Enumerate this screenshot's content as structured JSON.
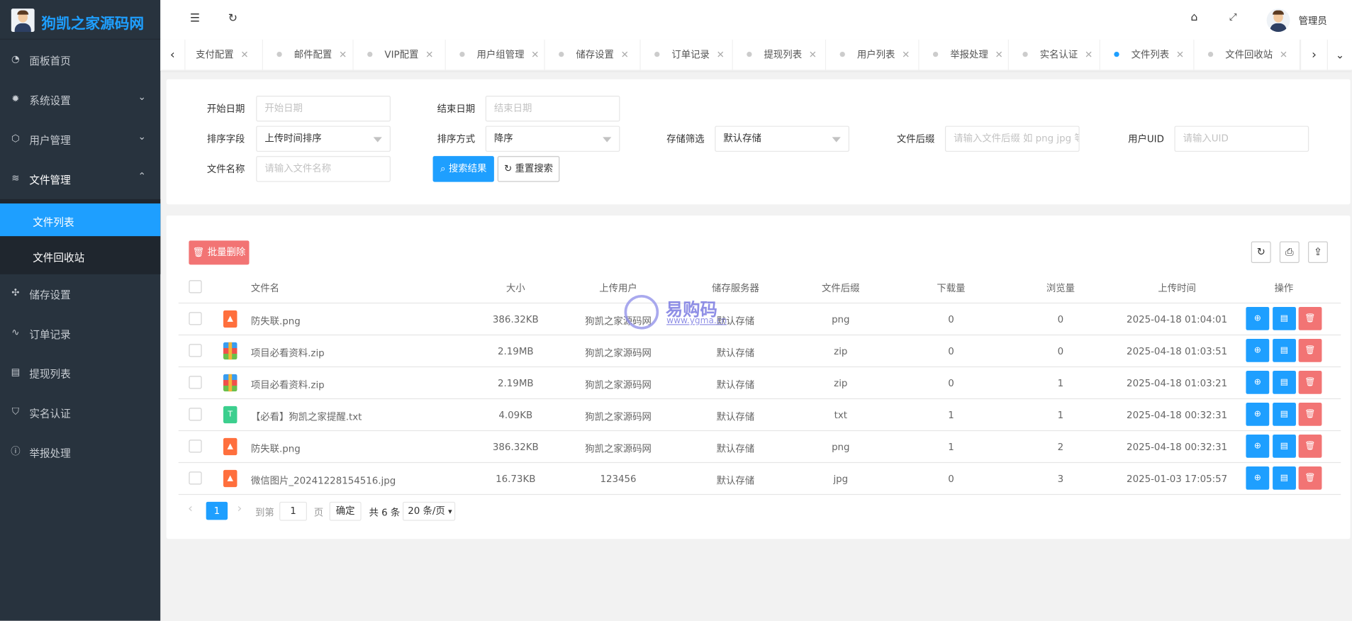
{
  "brand": {
    "title": "狗凯之家源码网"
  },
  "sidebar": {
    "items": [
      {
        "label": "面板首页",
        "icon": "dashboard-icon"
      },
      {
        "label": "系统设置",
        "icon": "gear-icon"
      },
      {
        "label": "用户管理",
        "icon": "cube-icon"
      },
      {
        "label": "文件管理",
        "icon": "layers-icon"
      },
      {
        "label": "储存设置",
        "icon": "storage-icon"
      },
      {
        "label": "订单记录",
        "icon": "pulse-icon"
      },
      {
        "label": "提现列表",
        "icon": "clipboard-icon"
      },
      {
        "label": "实名认证",
        "icon": "shield-icon"
      },
      {
        "label": "举报处理",
        "icon": "info-icon"
      }
    ],
    "submenu": [
      {
        "label": "文件列表",
        "active": true
      },
      {
        "label": "文件回收站"
      }
    ]
  },
  "header": {
    "user": "管理员"
  },
  "tabs": [
    {
      "label": "支付配置"
    },
    {
      "label": "邮件配置"
    },
    {
      "label": "VIP配置"
    },
    {
      "label": "用户组管理"
    },
    {
      "label": "储存设置"
    },
    {
      "label": "订单记录"
    },
    {
      "label": "提现列表"
    },
    {
      "label": "用户列表"
    },
    {
      "label": "举报处理"
    },
    {
      "label": "实名认证"
    },
    {
      "label": "文件列表",
      "active": true
    },
    {
      "label": "文件回收站"
    }
  ],
  "search": {
    "start_label": "开始日期",
    "start_placeholder": "开始日期",
    "end_label": "结束日期",
    "end_placeholder": "结束日期",
    "sort_field_label": "排序字段",
    "sort_field_value": "上传时间排序",
    "sort_order_label": "排序方式",
    "sort_order_value": "降序",
    "storage_label": "存储筛选",
    "storage_value": "默认存储",
    "ext_label": "文件后缀",
    "ext_placeholder": "请输入文件后缀 如 png jpg 等",
    "uid_label": "用户UID",
    "uid_placeholder": "请输入UID",
    "name_label": "文件名称",
    "name_placeholder": "请输入文件名称",
    "search_btn": "搜索结果",
    "reset_btn": "重置搜索"
  },
  "table": {
    "batch_delete": "批量删除",
    "columns": [
      "文件名",
      "大小",
      "上传用户",
      "储存服务器",
      "文件后缀",
      "下载量",
      "浏览量",
      "上传时间",
      "操作"
    ],
    "rows": [
      {
        "name": "防失联.png",
        "type": "image",
        "size": "386.32KB",
        "user": "狗凯之家源码网",
        "storage": "默认存储",
        "ext": "png",
        "downloads": "0",
        "views": "0",
        "time": "2025-04-18 01:04:01"
      },
      {
        "name": "项目必看资料.zip",
        "type": "zip",
        "size": "2.19MB",
        "user": "狗凯之家源码网",
        "storage": "默认存储",
        "ext": "zip",
        "downloads": "0",
        "views": "0",
        "time": "2025-04-18 01:03:51"
      },
      {
        "name": "项目必看资料.zip",
        "type": "zip",
        "size": "2.19MB",
        "user": "狗凯之家源码网",
        "storage": "默认存储",
        "ext": "zip",
        "downloads": "0",
        "views": "1",
        "time": "2025-04-18 01:03:21"
      },
      {
        "name": "【必看】狗凯之家提醒.txt",
        "type": "text",
        "size": "4.09KB",
        "user": "狗凯之家源码网",
        "storage": "默认存储",
        "ext": "txt",
        "downloads": "1",
        "views": "1",
        "time": "2025-04-18 00:32:31"
      },
      {
        "name": "防失联.png",
        "type": "image",
        "size": "386.32KB",
        "user": "狗凯之家源码网",
        "storage": "默认存储",
        "ext": "png",
        "downloads": "1",
        "views": "2",
        "time": "2025-04-18 00:32:31"
      },
      {
        "name": "微信图片_20241228154516.jpg",
        "type": "image",
        "size": "16.73KB",
        "user": "123456",
        "storage": "默认存储",
        "ext": "jpg",
        "downloads": "0",
        "views": "3",
        "time": "2025-01-03 17:05:57"
      }
    ]
  },
  "pagination": {
    "current": "1",
    "goto_label": "到第",
    "goto_value": "1",
    "page_suffix": "页",
    "confirm": "确定",
    "total": "共 6 条",
    "page_size": "20 条/页"
  },
  "watermark": {
    "title": "易购码",
    "url": "www.ygma.cn"
  },
  "colors": {
    "accent": "#1e9fff",
    "danger": "#f27474",
    "sidebar": "#28333e"
  }
}
